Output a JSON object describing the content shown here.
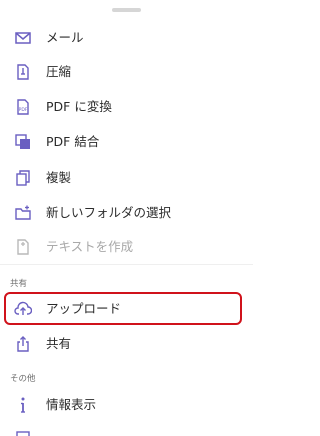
{
  "menu": {
    "items": [
      {
        "label": "メール",
        "icon": "mail-icon"
      },
      {
        "label": "圧縮",
        "icon": "compress-icon"
      },
      {
        "label": "PDF に変換",
        "icon": "convert-pdf-icon"
      },
      {
        "label": "PDF 結合",
        "icon": "merge-pdf-icon"
      },
      {
        "label": "複製",
        "icon": "duplicate-icon"
      },
      {
        "label": "新しいフォルダの選択",
        "icon": "new-folder-icon"
      },
      {
        "label": "テキストを作成",
        "icon": "create-text-icon",
        "disabled": true
      }
    ]
  },
  "sections": {
    "share": {
      "title": "共有",
      "items": [
        {
          "label": "アップロード",
          "icon": "upload-icon"
        },
        {
          "label": "共有",
          "icon": "share-icon"
        }
      ]
    },
    "other": {
      "title": "その他",
      "items": [
        {
          "label": "情報表示",
          "icon": "info-icon"
        }
      ]
    }
  },
  "colors": {
    "icon_accent": "#6a5fc1",
    "highlight_border": "#d0121b",
    "disabled_text": "#a9a9a9"
  }
}
